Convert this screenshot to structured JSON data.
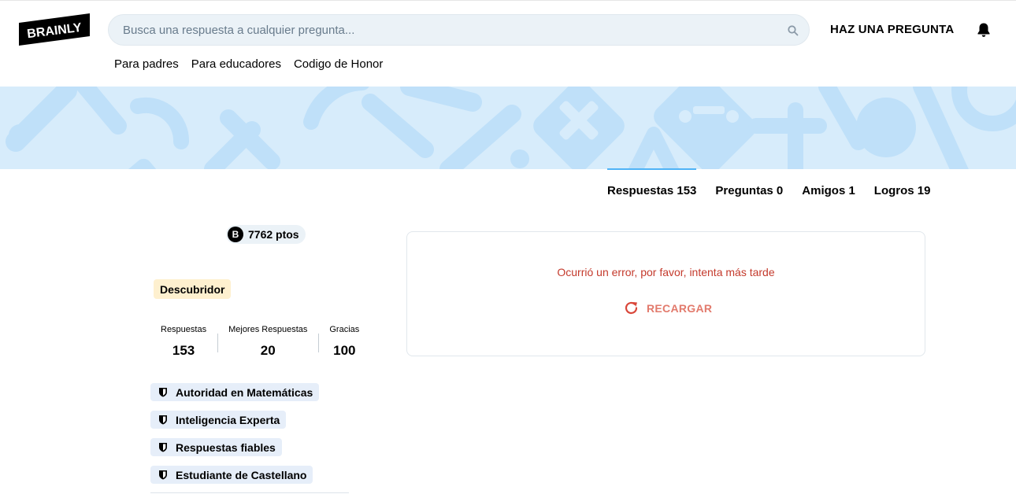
{
  "header": {
    "logo_text": "BRAINLY",
    "search_placeholder": "Busca una respuesta a cualquier pregunta...",
    "ask_label": "HAZ UNA PREGUNTA",
    "nav": [
      "Para padres",
      "Para educadores",
      "Codigo de Honor"
    ]
  },
  "tabs": [
    {
      "label": "Respuestas 153",
      "active": true
    },
    {
      "label": "Preguntas 0",
      "active": false
    },
    {
      "label": "Amigos 1",
      "active": false
    },
    {
      "label": "Logros 19",
      "active": false
    }
  ],
  "profile": {
    "points_badge": "B",
    "points": "7762 ptos",
    "rank": "Descubridor",
    "stats": [
      {
        "label": "Respuestas",
        "value": "153"
      },
      {
        "label": "Mejores Respuestas",
        "value": "20"
      },
      {
        "label": "Gracias",
        "value": "100"
      }
    ],
    "badges": [
      "Autoridad en Matemáticas",
      "Inteligencia Experta",
      "Respuestas fiables",
      "Estudiante de Castellano"
    ]
  },
  "error_card": {
    "message": "Ocurrió un error, por favor, intenta más tarde",
    "reload_label": "RECARGAR"
  },
  "colors": {
    "banner_bg": "#d7ecfb",
    "banner_shapes": "#bfe0f9",
    "accent_tab": "#4fb3f6",
    "error_text": "#c43a2c",
    "reload": "#e27a6c",
    "rank_bg": "#fef0cf",
    "badge_bg": "#e6eef9"
  },
  "icons": {
    "search": "search-icon",
    "bell": "bell-icon",
    "reload": "reload-icon",
    "shield": "shield-icon"
  }
}
